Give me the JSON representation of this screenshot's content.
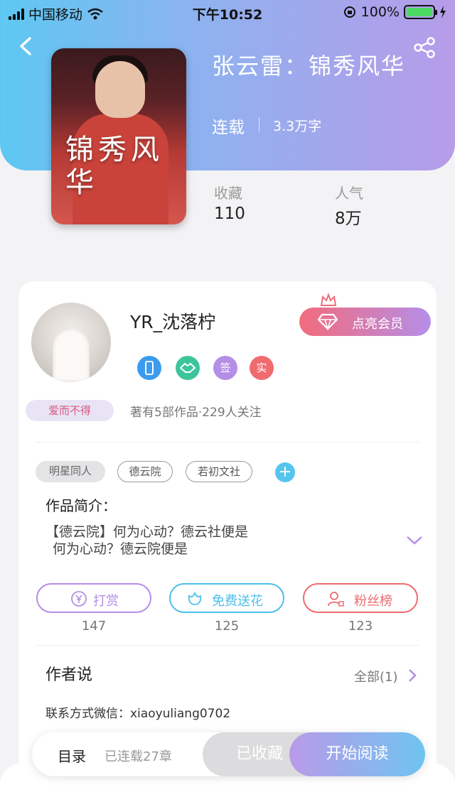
{
  "status_bar": {
    "carrier": "中国移动",
    "time": "下午10:52",
    "battery": "100%"
  },
  "book": {
    "title": "张云雷：锦秀风华",
    "cover_title": "锦秀风华",
    "status": "连载",
    "word_count": "3.3万字",
    "stats": [
      {
        "label": "收藏",
        "value": "110"
      },
      {
        "label": "人气",
        "value": "8万"
      }
    ]
  },
  "author": {
    "name": "YR_沈落柠",
    "avatar_badge": "爱而不得",
    "vip_button": "点亮会员",
    "badges": [
      {
        "text": "",
        "color": "#3a9bef",
        "icon": "phone-icon"
      },
      {
        "text": "",
        "color": "#3cc59b",
        "icon": "handshake-icon"
      },
      {
        "text": "签",
        "color": "#b58ee6"
      },
      {
        "text": "实",
        "color": "#ef6b70"
      }
    ],
    "works_info": "著有5部作品·229人关注"
  },
  "tags": [
    "明星同人",
    "德云院",
    "若初文社"
  ],
  "intro": {
    "title": "作品简介：",
    "lines": [
      "【德云院】何为心动？德云社便是",
      "何为心动？德云院便是"
    ]
  },
  "actions": [
    {
      "label": "打赏",
      "count": "147",
      "color": "#b58ee6",
      "icon": "yen-icon"
    },
    {
      "label": "免费送花",
      "count": "125",
      "color": "#4bbfe9",
      "icon": "flower-icon"
    },
    {
      "label": "粉丝榜",
      "count": "123",
      "color": "#ef6b70",
      "icon": "fans-icon"
    }
  ],
  "author_says": {
    "title": "作者说",
    "all_label": "全部(1)",
    "content": "联系方式微信：xiaoyuliang0702"
  },
  "bottom_bar": {
    "toc": "目录",
    "chapters": "已连载27章",
    "collected": "已收藏",
    "read": "开始阅读"
  }
}
